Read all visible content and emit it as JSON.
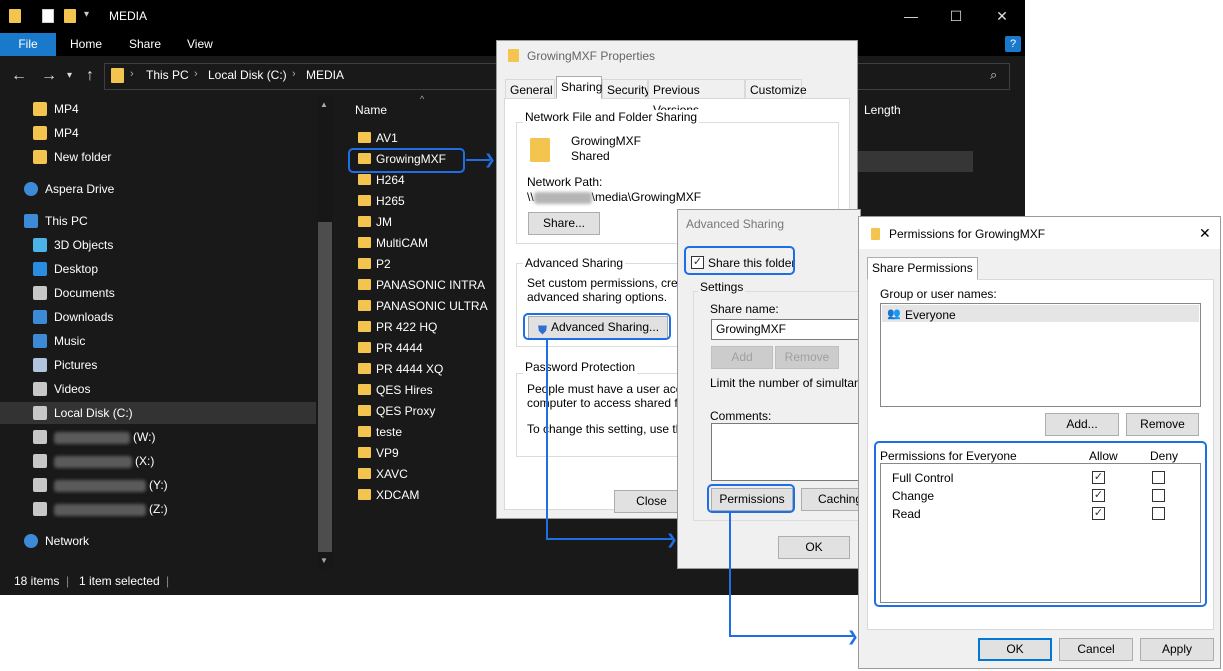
{
  "explorer": {
    "window_title": "MEDIA",
    "ribbon_tabs": [
      "File",
      "Home",
      "Share",
      "View"
    ],
    "help_label": "?",
    "breadcrumb": [
      "This PC",
      "Local Disk (C:)",
      "MEDIA"
    ],
    "nav_items": [
      {
        "label": "MP4",
        "icon": "folder-icon"
      },
      {
        "label": "MP4",
        "icon": "folder-icon"
      },
      {
        "label": "New folder",
        "icon": "folder-icon"
      },
      {
        "label": "Aspera Drive",
        "icon": "aspera-drive-icon"
      },
      {
        "label": "This PC",
        "icon": "computer-icon"
      },
      {
        "label": "3D Objects",
        "icon": "3d-objects-icon"
      },
      {
        "label": "Desktop",
        "icon": "desktop-icon"
      },
      {
        "label": "Documents",
        "icon": "documents-icon"
      },
      {
        "label": "Downloads",
        "icon": "downloads-icon"
      },
      {
        "label": "Music",
        "icon": "music-icon"
      },
      {
        "label": "Pictures",
        "icon": "pictures-icon"
      },
      {
        "label": "Videos",
        "icon": "videos-icon"
      },
      {
        "label": "Local Disk (C:)",
        "icon": "drive-icon"
      },
      {
        "label": "(W:)",
        "icon": "network-drive-icon"
      },
      {
        "label": "(X:)",
        "icon": "network-drive-icon"
      },
      {
        "label": "(Y:)",
        "icon": "network-drive-icon"
      },
      {
        "label": "(Z:)",
        "icon": "network-drive-icon"
      },
      {
        "label": "Network",
        "icon": "network-icon"
      }
    ],
    "columns": {
      "name": "Name",
      "length": "Length"
    },
    "files": [
      "AV1",
      "GrowingMXF",
      "H264",
      "H265",
      "JM",
      "MultiCAM",
      "P2",
      "PANASONIC INTRA",
      "PANASONIC ULTRA",
      "PR 422 HQ",
      "PR 4444",
      "PR 4444 XQ",
      "QES Hires",
      "QES Proxy",
      "teste",
      "VP9",
      "XAVC",
      "XDCAM"
    ],
    "selected_file": "GrowingMXF",
    "status": {
      "items": "18 items",
      "selected": "1 item selected"
    }
  },
  "properties": {
    "title": "GrowingMXF Properties",
    "tabs": [
      "General",
      "Sharing",
      "Security",
      "Previous Versions",
      "Customize"
    ],
    "active_tab": "Sharing",
    "nffs_group": "Network File and Folder Sharing",
    "folder_name": "GrowingMXF",
    "folder_state": "Shared",
    "network_path_label": "Network Path:",
    "network_path_prefix": "\\\\",
    "network_path_suffix": "\\media\\GrowingMXF",
    "share_button": "Share...",
    "adv_group": "Advanced Sharing",
    "adv_desc_1": "Set custom permissions, create m",
    "adv_desc_2": "advanced sharing options.",
    "adv_button": "Advanced Sharing...",
    "pwd_group": "Password Protection",
    "pwd_desc_1": "People must have a user accou",
    "pwd_desc_2": "computer to access shared folde",
    "pwd_desc_3": "To change this setting, use the",
    "close_button": "Close"
  },
  "advanced": {
    "title": "Advanced Sharing",
    "share_checkbox": "Share this folder",
    "settings_group": "Settings",
    "share_name_label": "Share name:",
    "share_name_value": "GrowingMXF",
    "add_button": "Add",
    "remove_button": "Remove",
    "limit_label": "Limit the number of simultaneou",
    "comments_label": "Comments:",
    "permissions_button": "Permissions",
    "caching_button": "Caching",
    "ok_button": "OK"
  },
  "permissions": {
    "title": "Permissions for GrowingMXF",
    "tab": "Share Permissions",
    "group_label": "Group or user names:",
    "users": [
      "Everyone"
    ],
    "add_button": "Add...",
    "remove_button": "Remove",
    "perm_header": "Permissions for Everyone",
    "allow_header": "Allow",
    "deny_header": "Deny",
    "rows": [
      {
        "name": "Full Control",
        "allow": true,
        "deny": false
      },
      {
        "name": "Change",
        "allow": true,
        "deny": false
      },
      {
        "name": "Read",
        "allow": true,
        "deny": false
      }
    ],
    "ok_button": "OK",
    "cancel_button": "Cancel",
    "apply_button": "Apply"
  },
  "colors": {
    "accent": "#1e6fe6",
    "folder": "#f3c54e",
    "file_tab": "#1979ca"
  }
}
